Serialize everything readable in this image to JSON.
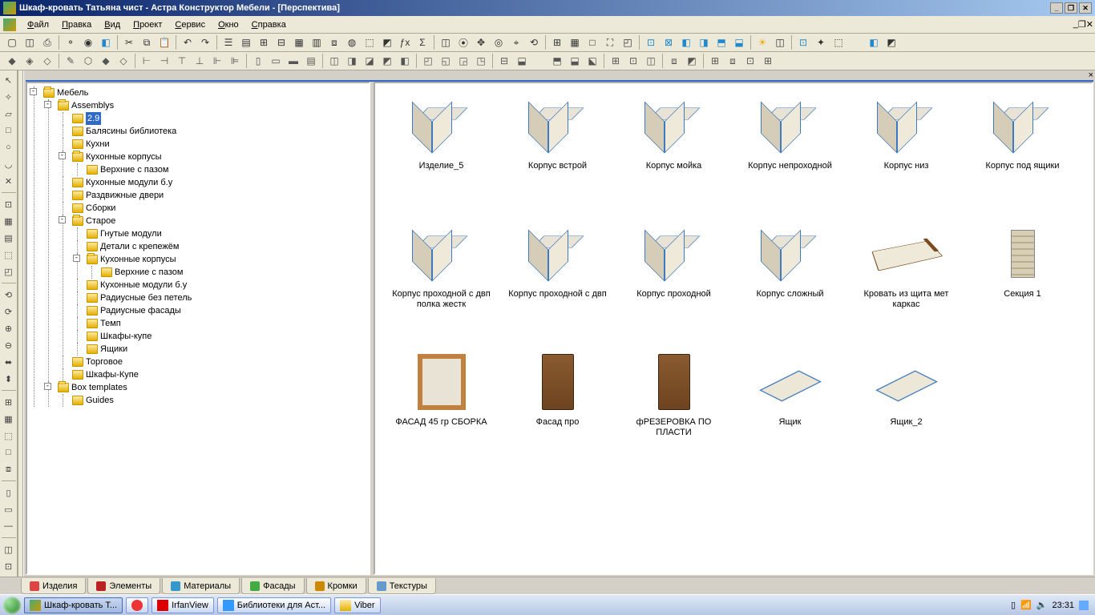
{
  "titlebar": "Шкаф-кровать Татьяна чист - Астра Конструктор Мебели - [Перспектива]",
  "menu": [
    "Файл",
    "Правка",
    "Вид",
    "Проект",
    "Сервис",
    "Окно",
    "Справка"
  ],
  "tree": {
    "root": "Мебель",
    "items": [
      {
        "label": "Assemblys",
        "exp": "-",
        "children": [
          {
            "label": "2.9",
            "sel": true
          },
          {
            "label": "Балясины библиотека"
          },
          {
            "label": "Кухни"
          },
          {
            "label": "Кухонные корпусы",
            "exp": "-",
            "children": [
              {
                "label": "Верхние с пазом"
              }
            ]
          },
          {
            "label": "Кухонные модули б.у"
          },
          {
            "label": "Раздвижные двери"
          },
          {
            "label": "Сборки"
          },
          {
            "label": "Старое",
            "exp": "-",
            "children": [
              {
                "label": "Гнутые модули"
              },
              {
                "label": "Детали с крепежём"
              },
              {
                "label": "Кухонные корпусы",
                "exp": "-",
                "children": [
                  {
                    "label": "Верхние с пазом"
                  }
                ]
              },
              {
                "label": "Кухонные модули б.у"
              },
              {
                "label": "Радиусные без петель"
              },
              {
                "label": "Радиусные фасады"
              },
              {
                "label": "Темп"
              },
              {
                "label": "Шкафы-купе"
              },
              {
                "label": "Ящики"
              }
            ]
          },
          {
            "label": "Торговое"
          },
          {
            "label": "Шкафы-Купе"
          }
        ]
      },
      {
        "label": "Box templates",
        "exp": "-",
        "children": [
          {
            "label": "Guides"
          }
        ]
      }
    ]
  },
  "thumbs": [
    "Изделие_5",
    "Корпус встрой",
    "Корпус мойка",
    "Корпус непроходной",
    "Корпус низ",
    "Корпус под ящики",
    "Корпус проходной с двп полка жестк",
    "Корпус проходной с двп",
    "Корпус проходной",
    "Корпус сложный",
    "Кровать из щита мет каркас",
    "Секция 1",
    "ФАСАД 45 гр СБОРКА",
    "Фасад про",
    "фРЕЗЕРОВКА ПО ПЛАСТИ",
    "Ящик",
    "Ящик_2"
  ],
  "tabs": [
    "Изделия",
    "Элементы",
    "Материалы",
    "Фасады",
    "Кромки",
    "Текстуры"
  ],
  "tabcolors": [
    "#d44",
    "#b22",
    "#39c",
    "#4a4",
    "#c80",
    "#69c"
  ],
  "taskbar": {
    "items": [
      "Шкаф-кровать Т...",
      "",
      "IrfanView",
      "Библиотеки для Аст...",
      "Viber"
    ],
    "clock": "23:31"
  }
}
